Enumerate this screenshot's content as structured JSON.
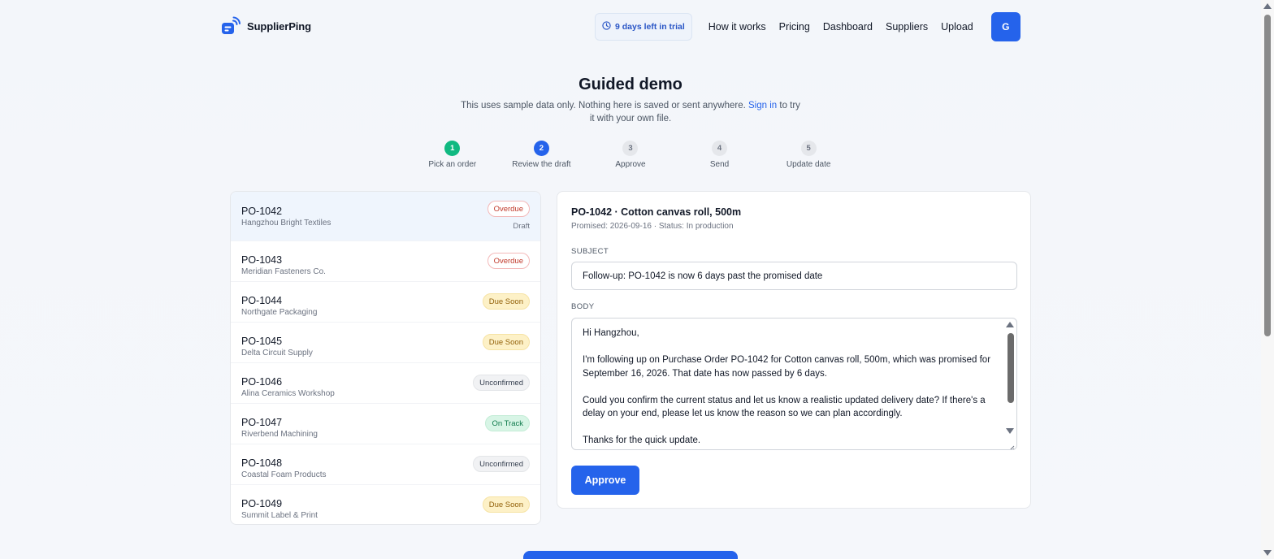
{
  "header": {
    "brand": "SupplierPing",
    "trial": "9 days left in trial",
    "nav": [
      "How it works",
      "Pricing",
      "Dashboard",
      "Suppliers",
      "Upload"
    ],
    "avatar": "G"
  },
  "intro": {
    "title": "Guided demo",
    "text_before": "This uses sample data only. Nothing here is saved or sent anywhere.",
    "link": "Sign in",
    "text_after": "to try it with your own file."
  },
  "steps": [
    {
      "num": "1",
      "label": "Pick an order",
      "state": "done"
    },
    {
      "num": "2",
      "label": "Review the draft",
      "state": "active"
    },
    {
      "num": "3",
      "label": "Approve",
      "state": "pending"
    },
    {
      "num": "4",
      "label": "Send",
      "state": "pending"
    },
    {
      "num": "5",
      "label": "Update date",
      "state": "pending"
    }
  ],
  "orders": [
    {
      "id": "PO-1042",
      "supplier": "Hangzhou Bright Textiles",
      "status": "Overdue",
      "note": "Draft"
    },
    {
      "id": "PO-1043",
      "supplier": "Meridian Fasteners Co.",
      "status": "Overdue"
    },
    {
      "id": "PO-1044",
      "supplier": "Northgate Packaging",
      "status": "Due Soon"
    },
    {
      "id": "PO-1045",
      "supplier": "Delta Circuit Supply",
      "status": "Due Soon"
    },
    {
      "id": "PO-1046",
      "supplier": "Alina Ceramics Workshop",
      "status": "Unconfirmed"
    },
    {
      "id": "PO-1047",
      "supplier": "Riverbend Machining",
      "status": "On Track"
    },
    {
      "id": "PO-1048",
      "supplier": "Coastal Foam Products",
      "status": "Unconfirmed"
    },
    {
      "id": "PO-1049",
      "supplier": "Summit Label & Print",
      "status": "Due Soon"
    }
  ],
  "draft": {
    "title": "PO-1042 · Cotton canvas roll, 500m",
    "meta": "Promised: 2026-09-16 · Status: In production",
    "subject_label": "SUBJECT",
    "subject": "Follow-up: PO-1042 is now 6 days past the promised date",
    "body_label": "BODY",
    "body": [
      "Hi Hangzhou,",
      "",
      "I'm following up on Purchase Order PO-1042 for Cotton canvas roll, 500m, which was promised for September 16, 2026. That date has now passed by 6 days.",
      "",
      "Could you confirm the current status and let us know a realistic updated delivery date? If there's a delay on your end, please let us know the reason so we can plan accordingly.",
      "",
      "Thanks for the quick update."
    ],
    "approve_label": "Approve"
  }
}
